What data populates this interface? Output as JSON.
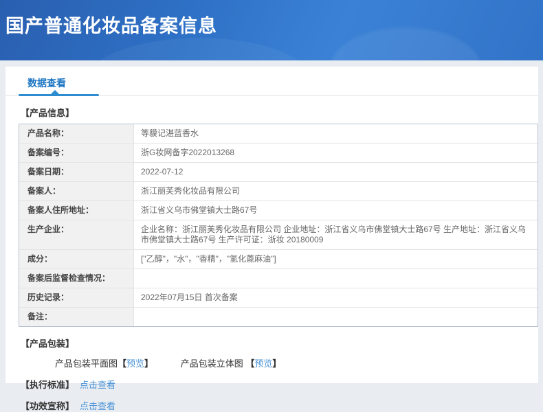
{
  "header": {
    "title": "国产普通化妆品备案信息"
  },
  "tabs": {
    "data_view": "数据查看"
  },
  "sections": {
    "product_info": "【产品信息】",
    "packaging": "【产品包装】",
    "standard": "【执行标准】",
    "efficacy": "【功效宣称】"
  },
  "product_table": {
    "rows": [
      {
        "label": "产品名称：",
        "value": "等貘记湛蓝香水"
      },
      {
        "label": "备案编号：",
        "value": "浙G妆网备字2022013268"
      },
      {
        "label": "备案日期：",
        "value": "2022-07-12"
      },
      {
        "label": "备案人：",
        "value": "浙江丽芙秀化妆品有限公司"
      },
      {
        "label": "备案人住所地址：",
        "value": "浙江省义乌市佛堂镇大士路67号"
      },
      {
        "label": "生产企业：",
        "value": "企业名称：浙江丽芙秀化妆品有限公司 企业地址：浙江省义乌市佛堂镇大士路67号 生产地址：浙江省义乌市佛堂镇大士路67号 生产许可证：浙妆 20180009"
      },
      {
        "label": "成分：",
        "value": "[\"乙醇\"，\"水\"，\"香精\"，\"氢化蓖麻油\"]"
      },
      {
        "label": "备案后监督检查情况：",
        "value": ""
      },
      {
        "label": "历史记录：",
        "value": "2022年07月15日 首次备案"
      },
      {
        "label": "备注：",
        "value": ""
      }
    ]
  },
  "packaging": {
    "flat_label": "产品包装平面图",
    "stereo_label": "产品包装立体图",
    "bracket_open": "【",
    "bracket_close": "】",
    "preview": "预览"
  },
  "links": {
    "click_view": "点击查看"
  },
  "colors": {
    "banner_blue": "#2e71c6",
    "tab_blue": "#1b74c2",
    "link_blue": "#4a93d6",
    "table_border": "#b7c3d3",
    "label_bg": "#f1f1f1"
  }
}
